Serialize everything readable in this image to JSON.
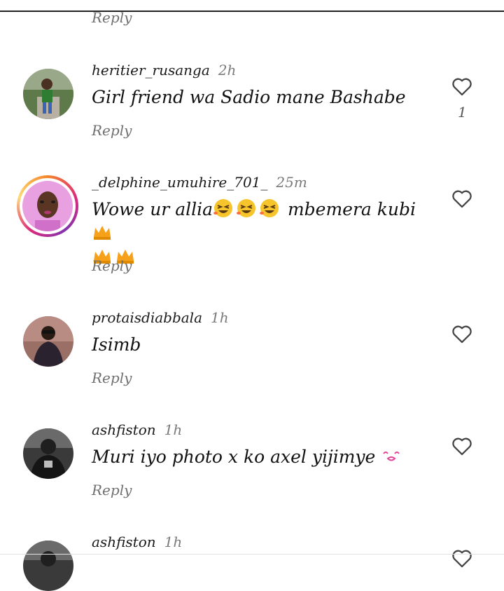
{
  "top_reply_label": "Reply",
  "comments": [
    {
      "username": "heritier_rusanga",
      "time": "2h",
      "text": "Girl friend wa Sadio mane Bashabe",
      "reply_label": "Reply",
      "likes": "1"
    },
    {
      "username": "_delphine_umuhire_701_",
      "time": "25m",
      "text_part1": "Wowe ur allia",
      "text_part2": " mbemera kubi",
      "reply_label": "Reply",
      "emojis": [
        "rolling-laughing-emoji",
        "rolling-laughing-emoji",
        "rolling-laughing-emoji",
        "crown-emoji",
        "crown-emoji",
        "crown-emoji"
      ]
    },
    {
      "username": "protaisdiabbala",
      "time": "1h",
      "text": "Isimb",
      "reply_label": "Reply"
    },
    {
      "username": "ashfiston",
      "time": "1h",
      "text": "Muri iyo photo x ko axel yijimye ",
      "reply_label": "Reply",
      "emojis": [
        "kissing-face-emoji"
      ]
    },
    {
      "username": "ashfiston",
      "time": "1h"
    }
  ],
  "icons": {
    "like": "heart-outline-icon"
  },
  "colors": {
    "story_ring": "#dd2a7b",
    "muted_text": "#707070"
  }
}
